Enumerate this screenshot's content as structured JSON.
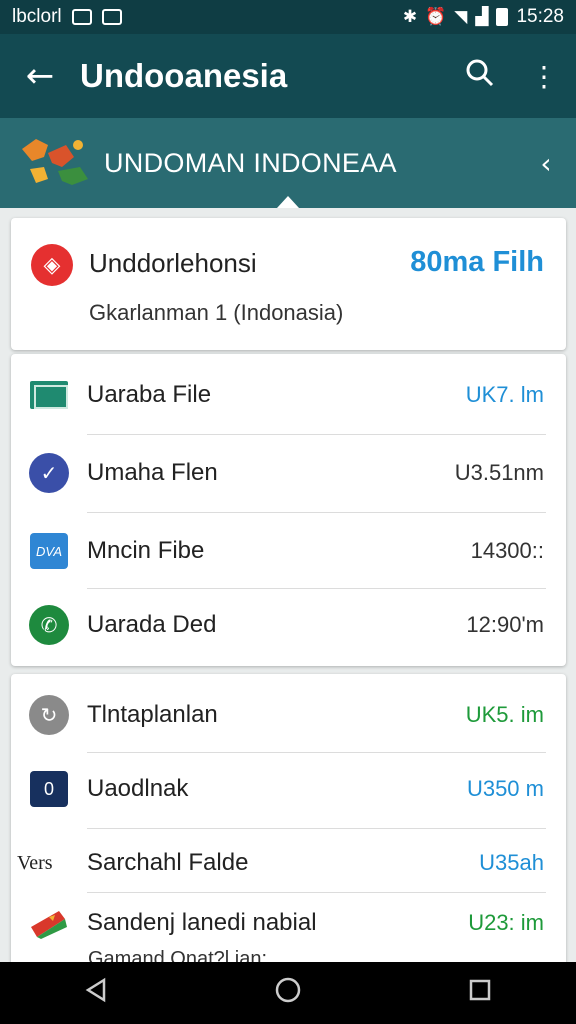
{
  "status_bar": {
    "carrier": "lbclorl",
    "time": "15:28",
    "icons": [
      "image-icon",
      "notification-icon",
      "bluetooth-icon",
      "alarm-icon",
      "wifi-icon",
      "signal-icon",
      "battery-icon"
    ]
  },
  "app_bar": {
    "title": "Undooanesia",
    "back_icon": "arrow-left-icon",
    "search_icon": "search-icon",
    "more_icon": "more-vert-icon"
  },
  "banner": {
    "text": "UNDOMAN INDONEAA",
    "map_icon": "indonesia-map-icon",
    "chevron_icon": "chevron-left-icon"
  },
  "header_card": {
    "name": "Unddorlehonsi",
    "amount": "80ma Filh",
    "subtitle": "Gkarlanman 1 (Indonasia)"
  },
  "list1": [
    {
      "label": "Uaraba File",
      "value": "UK7. lm",
      "icon": "mail-icon",
      "value_color": "#1f8fd6"
    },
    {
      "label": "Umaha Flen",
      "value": "U3.51nm",
      "icon": "check-circle-icon",
      "value_color": "#333333"
    },
    {
      "label": "Mncin Fibe",
      "value": "14300::",
      "icon": "card-icon",
      "value_color": "#333333"
    },
    {
      "label": "Uarada Ded",
      "value": "12:90'm",
      "icon": "phone-icon",
      "value_color": "#333333"
    }
  ],
  "list2": [
    {
      "label": "Tlntaplanlan",
      "value": "UK5. im",
      "icon": "clock-icon",
      "value_color": "#1e9a3a"
    },
    {
      "label": "Uaodlnak",
      "value": "U350 m",
      "icon": "badge-icon",
      "value_color": "#1f8fd6"
    },
    {
      "label": "Sarchahl Falde",
      "value": "U35ah",
      "icon": "vers-text-icon",
      "icon_text": "Vers",
      "value_color": "#1f8fd6"
    },
    {
      "label": "Sandenj lanedi nabial",
      "value": "U23: im",
      "icon": "flag-icon",
      "value_color": "#1e9a3a"
    }
  ],
  "clipped_text": "Gamand Onat?l ian:",
  "nav_bar": {
    "back_icon": "nav-back-icon",
    "home_icon": "nav-home-icon",
    "recents_icon": "nav-recents-icon"
  }
}
